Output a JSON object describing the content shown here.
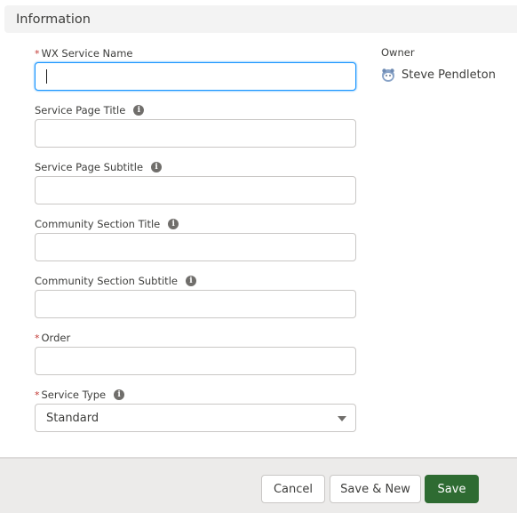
{
  "section": {
    "title": "Information"
  },
  "fields": [
    {
      "label": "WX Service Name",
      "required": true,
      "info": false,
      "value": "",
      "focused": true
    },
    {
      "label": "Service Page Title",
      "required": false,
      "info": true,
      "value": ""
    },
    {
      "label": "Service Page Subtitle",
      "required": false,
      "info": true,
      "value": ""
    },
    {
      "label": "Community Section Title",
      "required": false,
      "info": true,
      "value": ""
    },
    {
      "label": "Community Section Subtitle",
      "required": false,
      "info": true,
      "value": ""
    },
    {
      "label": "Order",
      "required": true,
      "info": false,
      "value": ""
    },
    {
      "label": "Service Type",
      "required": true,
      "info": true,
      "value": "Standard",
      "type": "select"
    }
  ],
  "owner": {
    "label": "Owner",
    "name": "Steve Pendleton",
    "avatar_icon": "user-avatar-icon"
  },
  "footer": {
    "cancel_label": "Cancel",
    "save_new_label": "Save & New",
    "save_label": "Save"
  },
  "symbols": {
    "required_marker": "*",
    "info_glyph": "i"
  },
  "colors": {
    "brand_button": "#2e6b32",
    "focus_border": "#1b96ff",
    "required_marker": "#c23934"
  }
}
